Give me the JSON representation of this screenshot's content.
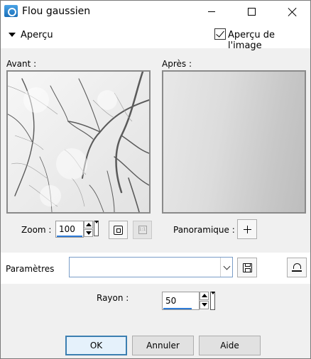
{
  "window": {
    "title": "Flou gaussien"
  },
  "preview": {
    "section_label": "Aperçu",
    "image_preview_label": "Aperçu de l'image",
    "image_preview_checked": true,
    "before_label": "Avant :",
    "after_label": "Après :"
  },
  "zoom": {
    "label": "Zoom :",
    "value": "100"
  },
  "pan": {
    "label": "Panoramique :"
  },
  "params": {
    "label": "Paramètres",
    "preset_value": ""
  },
  "radius": {
    "label": "Rayon :",
    "value": "50"
  },
  "buttons": {
    "ok": "OK",
    "cancel": "Annuler",
    "help": "Aide"
  },
  "icons": {
    "app": "paint-shop-icon",
    "fit": "fit-to-window-icon",
    "actual_size": "actual-size-icon",
    "pan": "move-icon",
    "save": "save-icon",
    "reset": "reset-icon"
  },
  "colors": {
    "accent": "#2e7bd6",
    "default_button_border": "#3c7fb1"
  }
}
